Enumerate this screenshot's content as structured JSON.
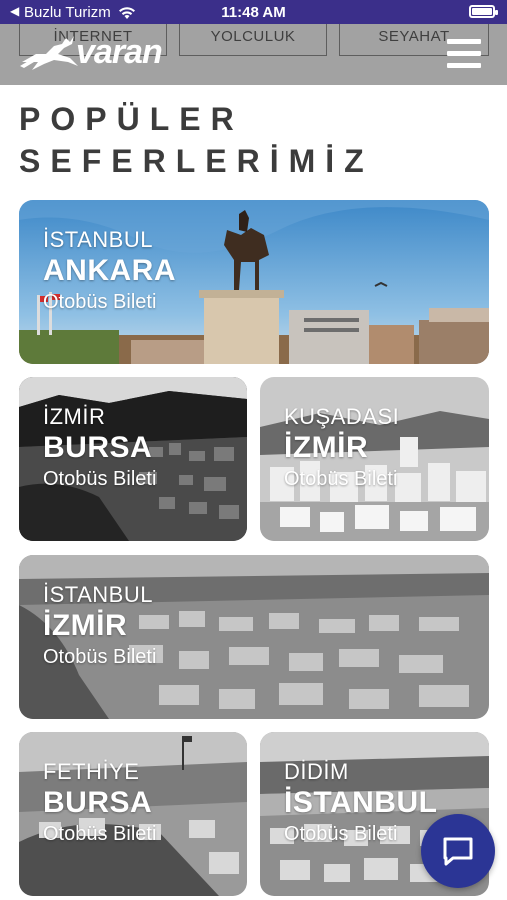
{
  "status_bar": {
    "back_glyph": "◀",
    "carrier": "Buzlu Turizm",
    "time": "11:48 AM",
    "icons": [
      "wifi-icon",
      "battery-icon"
    ]
  },
  "header": {
    "tabs": [
      "İNTERNET",
      "YOLCULUK",
      "SEYAHAT"
    ],
    "logo_text": "varan",
    "menu_icon": "hamburger-icon",
    "background": "#a2a2a2"
  },
  "section": {
    "title_line1": "POPÜLER",
    "title_line2": "SEFERLERİMİZ"
  },
  "routes": [
    {
      "from": "İSTANBUL",
      "to": "ANKARA",
      "type": "Otobüs Bileti"
    },
    {
      "from": "İZMİR",
      "to": "BURSA",
      "type": "Otobüs Bileti"
    },
    {
      "from": "KUŞADASI",
      "to": "İZMİR",
      "type": "Otobüs Bileti"
    },
    {
      "from": "İSTANBUL",
      "to": "İZMİR",
      "type": "Otobüs Bileti"
    },
    {
      "from": "FETHİYE",
      "to": "BURSA",
      "type": "Otobüs Bileti"
    },
    {
      "from": "DİDİM",
      "to": "İSTANBUL",
      "type": "Otobüs Bileti"
    }
  ],
  "chat_button": {
    "icon": "chat-bubble-icon",
    "color": "#2b3595"
  },
  "colors": {
    "status_bar": "#3b2f8a",
    "title_text": "#3c3c3c"
  }
}
